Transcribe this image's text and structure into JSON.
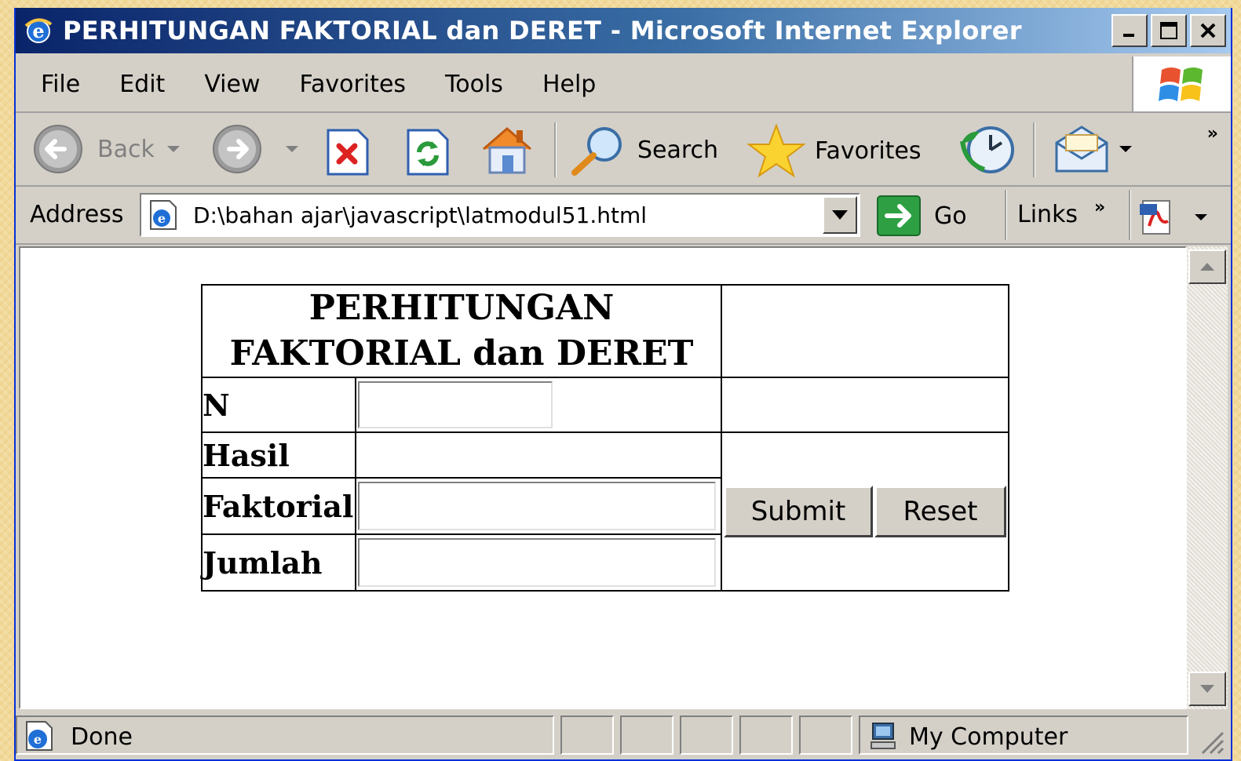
{
  "window": {
    "title": "PERHITUNGAN FAKTORIAL dan DERET - Microsoft Internet Explorer"
  },
  "menu": {
    "items": [
      "File",
      "Edit",
      "View",
      "Favorites",
      "Tools",
      "Help"
    ]
  },
  "toolbar": {
    "back_label": "Back",
    "search_label": "Search",
    "favorites_label": "Favorites",
    "overflow": "»"
  },
  "address": {
    "label": "Address",
    "value": "D:\\bahan ajar\\javascript\\latmodul51.html",
    "go_label": "Go",
    "links_label": "Links",
    "links_overflow": "»"
  },
  "form": {
    "header_line1": "PERHITUNGAN",
    "header_line2": "FAKTORIAL dan DERET",
    "n_label": "N",
    "hasil_label": "Hasil",
    "faktorial_label": "Faktorial",
    "jumlah_label": "Jumlah",
    "n_value": "",
    "faktorial_value": "",
    "jumlah_value": "",
    "submit_label": "Submit",
    "reset_label": "Reset"
  },
  "status": {
    "text": "Done",
    "zone": "My Computer"
  },
  "colors": {
    "titlebar_start": "#0a246a",
    "titlebar_end": "#a6caf0",
    "chrome": "#d4d0c8",
    "background": "#f1d99a"
  }
}
